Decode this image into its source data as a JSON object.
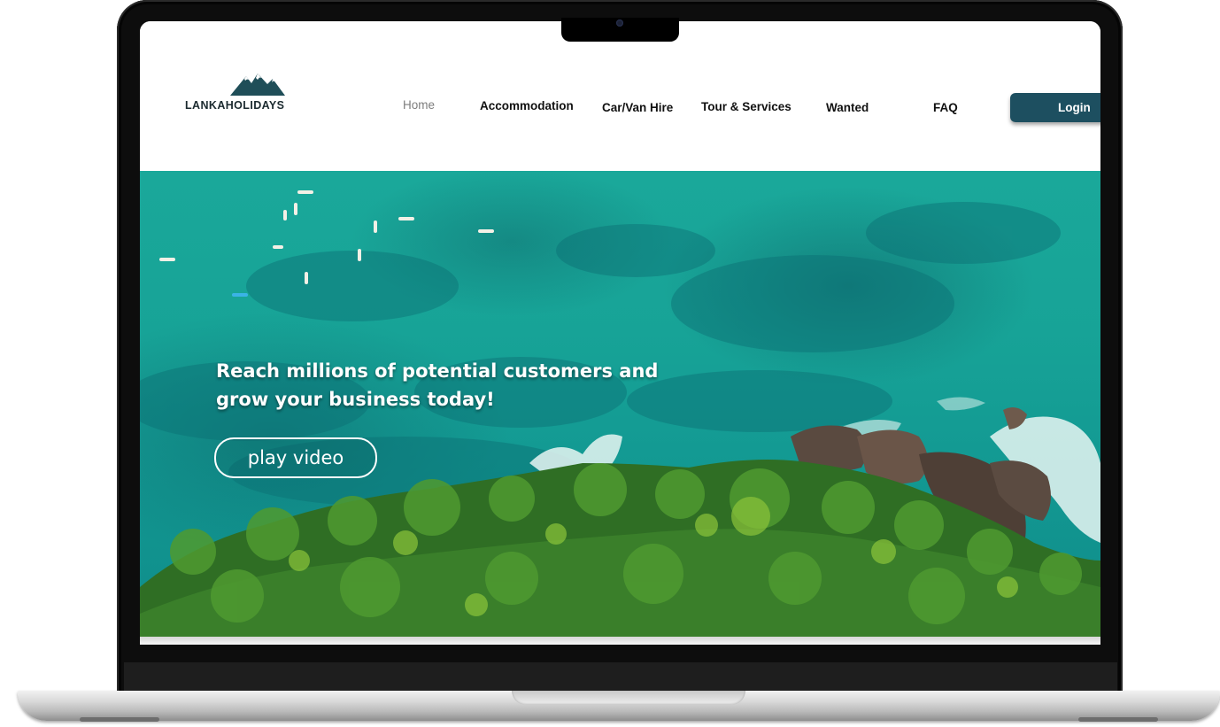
{
  "brand": {
    "name": "LANKAHOLIDAYS",
    "accent": "#1d4f60",
    "logo_icon": "mountain-icon"
  },
  "nav": {
    "items": [
      {
        "label": "Home",
        "active": true
      },
      {
        "label": "Accommodation",
        "active": false
      },
      {
        "label": "Car/Van Hire",
        "active": false
      },
      {
        "label": "Tour & Services",
        "active": false
      },
      {
        "label": "Wanted",
        "active": false
      },
      {
        "label": "FAQ",
        "active": false
      }
    ],
    "login_label": "Login"
  },
  "hero": {
    "headline_line1": "Reach millions of potential customers and",
    "headline_line2": "grow your business today!",
    "cta_label": "play video",
    "ocean_color": "#17a397",
    "forest_color": "#2f6e24"
  }
}
